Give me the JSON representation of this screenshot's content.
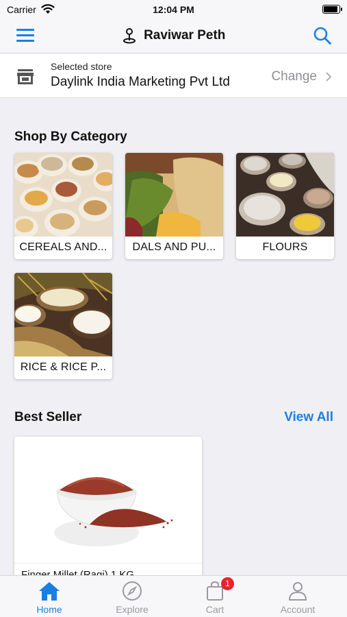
{
  "status_bar": {
    "carrier": "Carrier",
    "time": "12:04 PM"
  },
  "header": {
    "title": "Raviwar Peth",
    "menu_icon": "hamburger-menu-icon",
    "location_icon": "map-pin-icon",
    "search_icon": "search-icon"
  },
  "store": {
    "label": "Selected store",
    "name": "Daylink India Marketing Pvt Ltd",
    "change_label": "Change"
  },
  "categories_section": {
    "title": "Shop By Category",
    "items": [
      {
        "label": "CEREALS AND..."
      },
      {
        "label": "DALS AND PU..."
      },
      {
        "label": "FLOURS"
      },
      {
        "label": "RICE & RICE P..."
      }
    ]
  },
  "best_seller_section": {
    "title": "Best Seller",
    "view_all_label": "View All",
    "products": [
      {
        "name": "Finger Millet (Ragi) 1 KG"
      }
    ]
  },
  "tab_bar": {
    "tabs": [
      {
        "label": "Home",
        "icon": "home-icon",
        "active": true
      },
      {
        "label": "Explore",
        "icon": "compass-icon",
        "active": false
      },
      {
        "label": "Cart",
        "icon": "cart-icon",
        "active": false,
        "badge": "1"
      },
      {
        "label": "Account",
        "icon": "account-icon",
        "active": false
      }
    ]
  },
  "colors": {
    "accent": "#1a7ee0",
    "badge": "#e8222d",
    "background": "#f0f0f4"
  }
}
